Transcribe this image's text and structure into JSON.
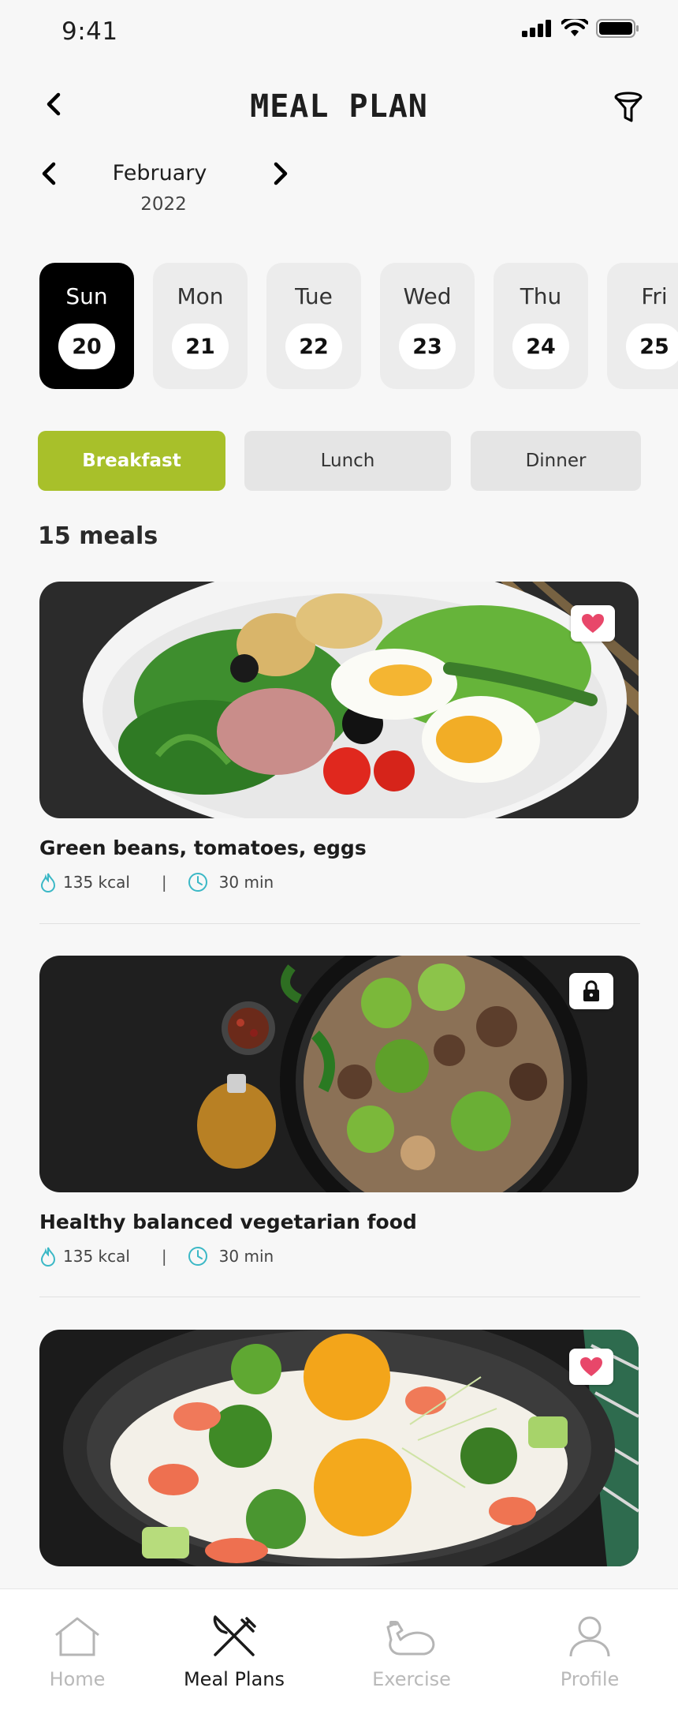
{
  "status_bar": {
    "time": "9:41"
  },
  "header": {
    "title": "MEAL PLAN"
  },
  "month_selector": {
    "month": "February",
    "year": "2022"
  },
  "days": [
    {
      "name": "Sun",
      "num": "20"
    },
    {
      "name": "Mon",
      "num": "21"
    },
    {
      "name": "Tue",
      "num": "22"
    },
    {
      "name": "Wed",
      "num": "23"
    },
    {
      "name": "Thu",
      "num": "24"
    },
    {
      "name": "Fri",
      "num": "25"
    }
  ],
  "meal_tabs": [
    "Breakfast",
    "Lunch",
    "Dinner"
  ],
  "meals_count": "15 meals",
  "meals": [
    {
      "title": "Green beans, tomatoes, eggs",
      "kcal": "135 kcal",
      "sep": "|",
      "time": "30 min",
      "badge": "heart-icon"
    },
    {
      "title": "Healthy balanced vegetarian food",
      "kcal": "135 kcal",
      "sep": "|",
      "time": "30 min",
      "badge": "lock-icon"
    },
    {
      "title": "",
      "kcal": "",
      "sep": "",
      "time": "",
      "badge": "heart-icon"
    }
  ],
  "nav": [
    "Home",
    "Meal Plans",
    "Exercise",
    "Profile"
  ],
  "colors": {
    "accent": "#a8c02a",
    "heart": "#e8476a",
    "meta_icon": "#3bb8c6"
  }
}
